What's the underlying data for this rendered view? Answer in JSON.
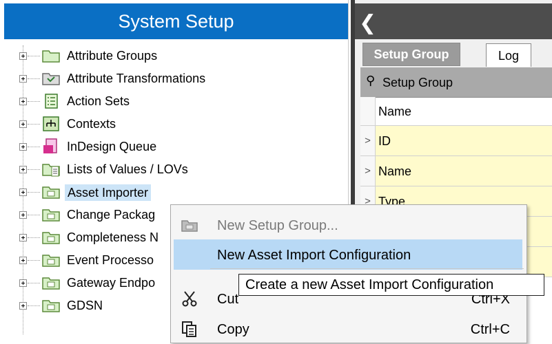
{
  "left_panel": {
    "title": "System Setup",
    "tree": [
      {
        "label": "Attribute Groups",
        "icon": "folder-icon"
      },
      {
        "label": "Attribute Transformations",
        "icon": "transformation-icon"
      },
      {
        "label": "Action Sets",
        "icon": "action-set-icon"
      },
      {
        "label": "Contexts",
        "icon": "contexts-icon"
      },
      {
        "label": "InDesign Queue",
        "icon": "indesign-queue-icon"
      },
      {
        "label": "Lists of Values / LOVs",
        "icon": "lov-icon"
      },
      {
        "label": "Asset Importer",
        "icon": "setup-folder-icon",
        "selected": true
      },
      {
        "label": "Change Packag",
        "icon": "setup-folder-icon"
      },
      {
        "label": "Completeness N",
        "icon": "setup-folder-icon"
      },
      {
        "label": "Event Processo",
        "icon": "setup-folder-icon"
      },
      {
        "label": "Gateway Endpo",
        "icon": "setup-folder-icon"
      },
      {
        "label": "GDSN",
        "icon": "setup-folder-icon"
      }
    ],
    "header_color": "#0a6fc4"
  },
  "right_panel": {
    "tabs": [
      {
        "label": "Setup Group",
        "active": true
      },
      {
        "label": "Log",
        "active": false
      }
    ],
    "grid": {
      "header": "Setup Group",
      "rows": [
        {
          "marker": "",
          "label": "Name"
        },
        {
          "marker": ">",
          "label": "ID"
        },
        {
          "marker": ">",
          "label": "Name"
        },
        {
          "marker": ">",
          "label": "Type"
        }
      ]
    }
  },
  "context_menu": {
    "items": [
      {
        "label": "New Setup Group...",
        "disabled": true,
        "icon": "folder-icon"
      },
      {
        "label": "New Asset Import Configuration",
        "highlighted": true
      },
      {
        "label": "Cut",
        "shortcut": "Ctrl+X",
        "icon": "scissors-icon"
      },
      {
        "label": "Copy",
        "shortcut": "Ctrl+C",
        "icon": "copy-icon"
      }
    ],
    "highlight_color": "#b8d9f5"
  },
  "tooltip": {
    "text": "Create a new Asset Import Configuration"
  }
}
